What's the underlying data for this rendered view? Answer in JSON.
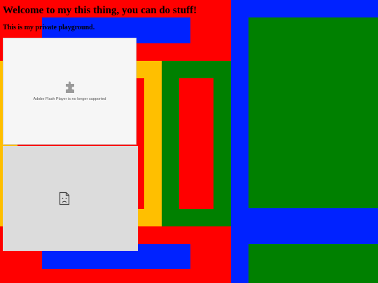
{
  "page": {
    "heading": "Welcome to my this thing, you can do stuff!",
    "subheading": "This is my private playground."
  },
  "flash_plugin": {
    "message": "Adobe Flash Player is no longer supported",
    "icon": "puzzle-piece-icon"
  },
  "broken_embed": {
    "icon": "sad-document-icon"
  },
  "colors": {
    "red": "#ff0000",
    "blue": "#0022ff",
    "green": "#008000",
    "yellow": "#ffbf00",
    "plugin_bg": "#f6f6f6",
    "broken_bg": "#dcdcdc"
  }
}
